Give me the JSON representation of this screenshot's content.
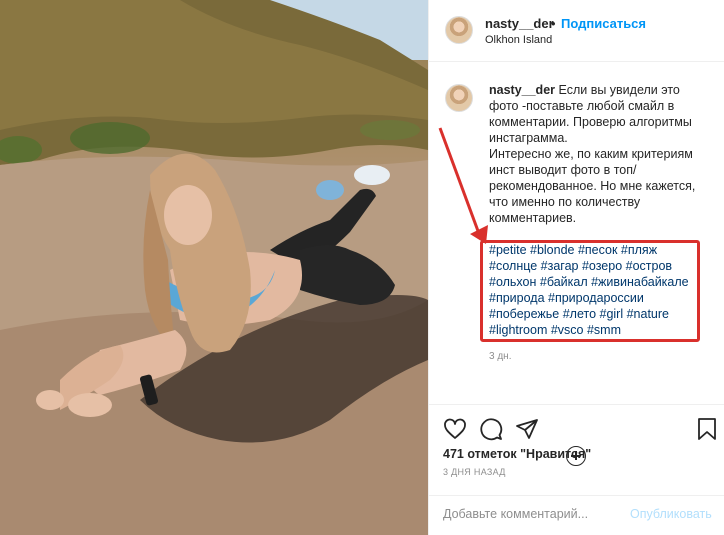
{
  "header": {
    "username": "nasty__der",
    "separator": "•",
    "follow_label": "Подписаться",
    "location": "Olkhon Island"
  },
  "caption": {
    "username": "nasty__der",
    "lines": [
      "Если вы увидели это фото -поставьте любой смайл в комментарии. Проверю алгоритмы инстаграмма.",
      "Интересно же, по каким критериям инст выводит фото в топ/ рекомендованное. Но мне кажется, что именно по количеству комментариев."
    ],
    "hashtags": "#petite #blonde #песок #пляж #солнце #загар #озеро #остров #ольхон #байкал #живинабайкале #природа #природароссии #побережье #лето #girl #nature #lightroom #vsco #smm",
    "time": "3 дн."
  },
  "actions": {
    "like_icon": "heart-icon",
    "comment_icon": "speech-bubble-icon",
    "share_icon": "paper-plane-icon",
    "save_icon": "bookmark-icon",
    "likes_text": "471 отметок \"Нравится\"",
    "time_ago": "3 ДНЯ НАЗАД"
  },
  "comment": {
    "placeholder": "Добавьте комментарий...",
    "publish_label": "Опубликовать"
  },
  "colors": {
    "link": "#0095f6",
    "hashtag": "#00376b",
    "highlight": "#d9302c",
    "muted": "#8e8e8e"
  }
}
